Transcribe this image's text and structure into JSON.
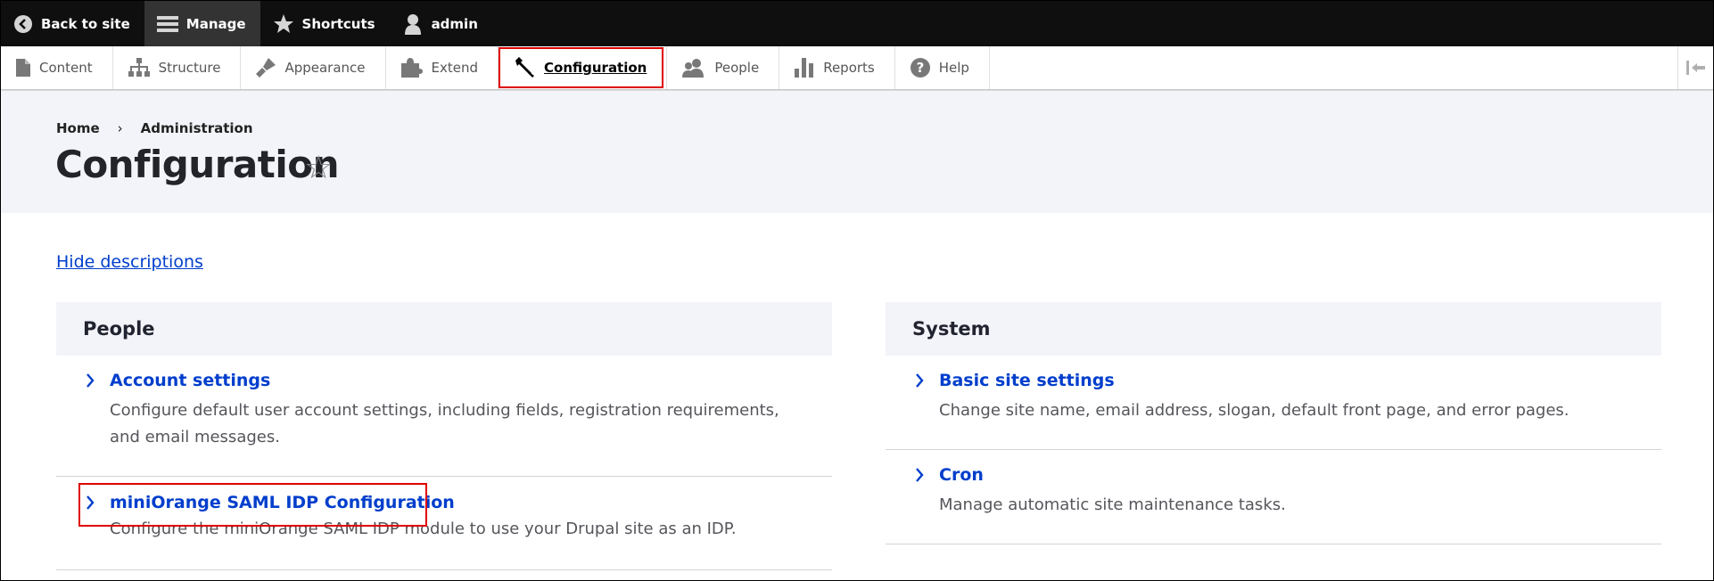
{
  "toolbar": {
    "back_to_site": "Back to site",
    "manage": "Manage",
    "shortcuts": "Shortcuts",
    "user": "admin"
  },
  "tray": {
    "items": [
      {
        "label": "Content",
        "icon": "file-icon"
      },
      {
        "label": "Structure",
        "icon": "sitemap-icon"
      },
      {
        "label": "Appearance",
        "icon": "brush-icon"
      },
      {
        "label": "Extend",
        "icon": "puzzle-icon"
      },
      {
        "label": "Configuration",
        "icon": "wrench-icon",
        "active": true
      },
      {
        "label": "People",
        "icon": "people-icon"
      },
      {
        "label": "Reports",
        "icon": "bar-chart-icon"
      },
      {
        "label": "Help",
        "icon": "help-icon"
      }
    ]
  },
  "breadcrumb": {
    "home": "Home",
    "separator": "›",
    "admin": "Administration"
  },
  "page": {
    "title": "Configuration",
    "star": "☆"
  },
  "hide_descriptions": "Hide descriptions",
  "panels": {
    "people": {
      "title": "People",
      "entries": [
        {
          "title": "Account settings",
          "description": "Configure default user account settings, including fields, registration requirements, and email messages."
        },
        {
          "title": "miniOrange SAML IDP Configuration",
          "description": "Configure the miniOrange SAML IDP module to use your Drupal site as an IDP."
        }
      ]
    },
    "system": {
      "title": "System",
      "entries": [
        {
          "title": "Basic site settings",
          "description": "Change site name, email address, slogan, default front page, and error pages."
        },
        {
          "title": "Cron",
          "description": "Manage automatic site maintenance tasks."
        }
      ]
    }
  },
  "colors": {
    "link": "#003ecc",
    "highlight": "#e00000",
    "toolbar_bg": "#0f0f0f",
    "header_bg": "#f3f4f9"
  }
}
